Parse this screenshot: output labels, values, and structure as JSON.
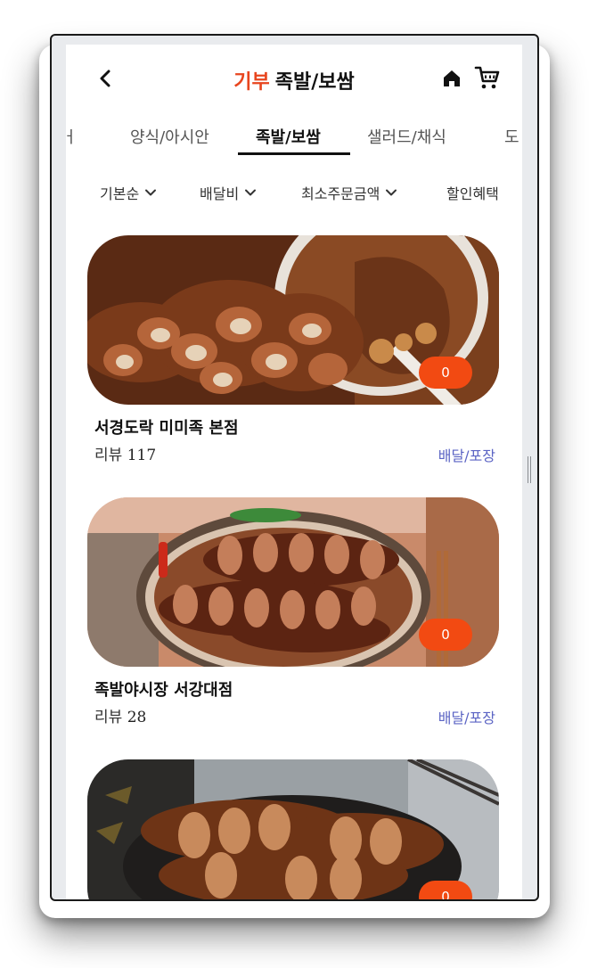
{
  "header": {
    "brand": "기부",
    "title": "족발/보쌈"
  },
  "tabs": [
    "ㅓ",
    "양식/아시안",
    "족발/보쌈",
    "샐러드/채식",
    "도"
  ],
  "active_tab": "족발/보쌈",
  "filters": [
    "기본순",
    "배달비",
    "최소주문금액",
    "할인혜택"
  ],
  "restaurants": [
    {
      "name": "서경도락 미미족 본점",
      "review_label": "리뷰",
      "review_count": "117",
      "delivery": "배달/포장",
      "badge": "0"
    },
    {
      "name": "족발야시장 서강대점",
      "review_label": "리뷰",
      "review_count": "28",
      "delivery": "배달/포장",
      "badge": "0"
    },
    {
      "name": "",
      "review_label": "",
      "review_count": "",
      "delivery": "",
      "badge": "0"
    }
  ],
  "colors": {
    "brand": "#e8451e",
    "badge": "#f24a12",
    "delivery": "#5b64c4"
  },
  "icons": {
    "back": "chevron-left-icon",
    "home": "home-icon",
    "cart": "cart-icon",
    "filter": "chevron-down-icon"
  }
}
